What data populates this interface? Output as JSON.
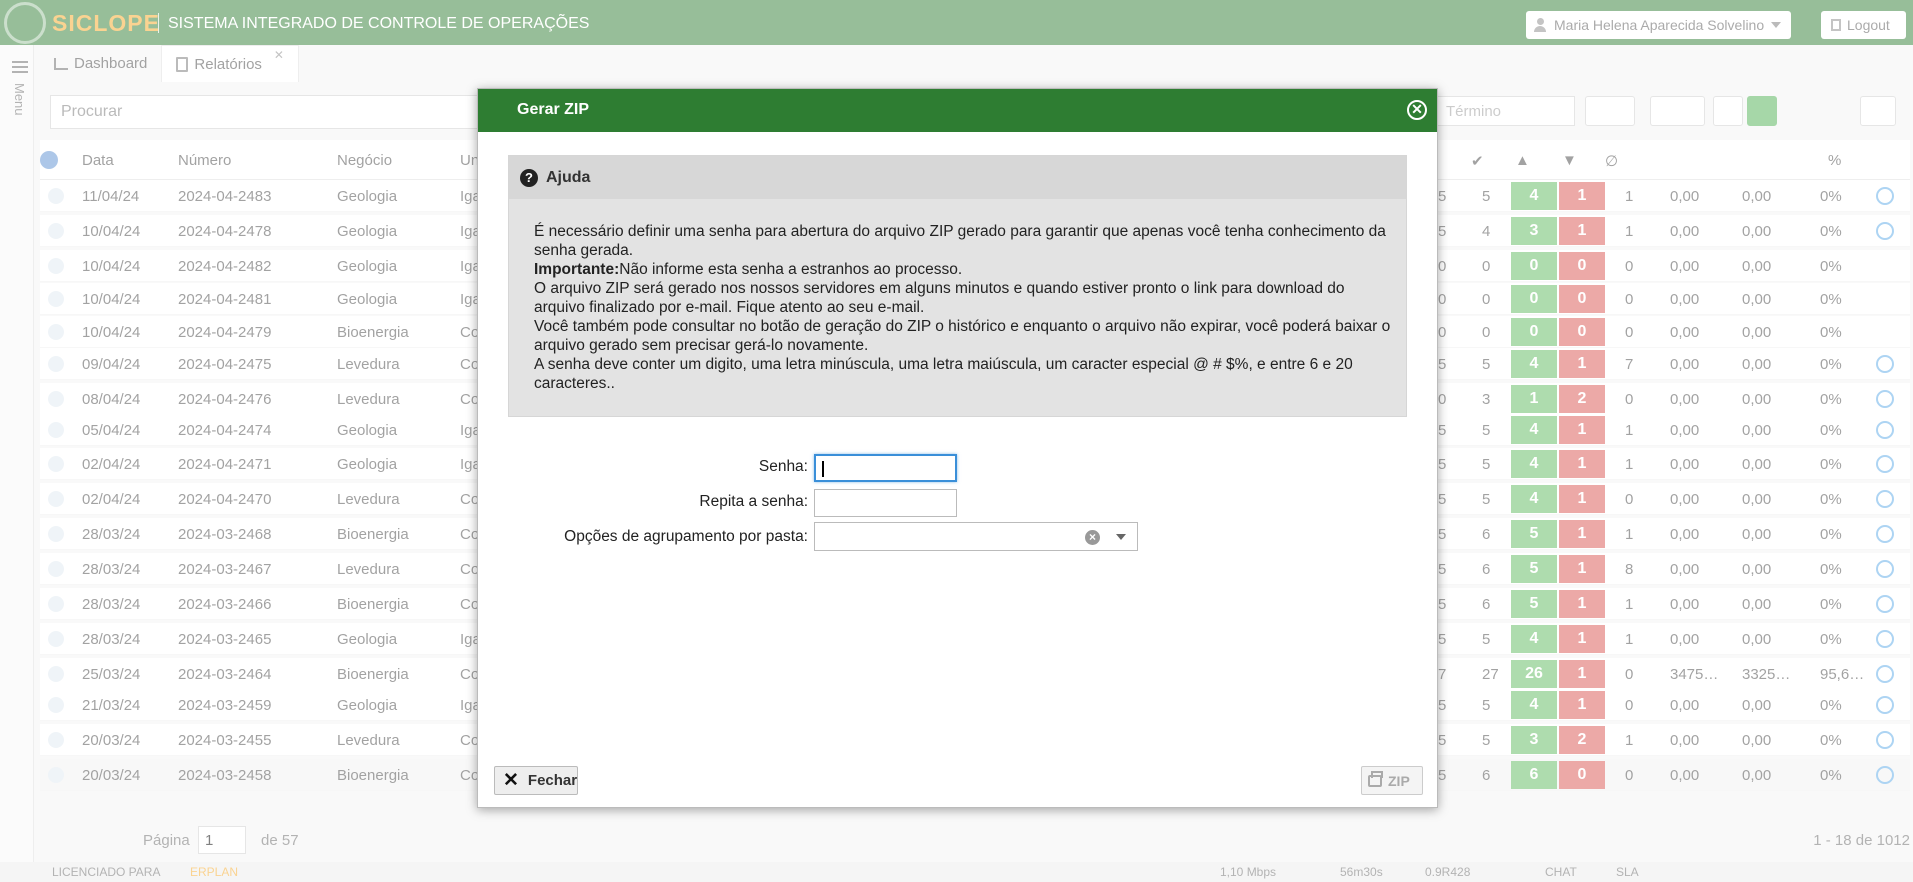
{
  "app": {
    "brand": "SICLOPE",
    "subtitle": "SISTEMA INTEGRADO DE CONTROLE DE OPERAÇÕES",
    "user": "Maria Helena Aparecida Solvelino",
    "logout": "Logout",
    "menu_label": "Menu",
    "tabs": [
      {
        "label": "Dashboard"
      },
      {
        "label": "Relatórios"
      }
    ],
    "search_placeholder": "Procurar",
    "termino_placeholder": "Término",
    "columns": [
      "Data",
      "Número",
      "Negócio",
      "Un"
    ],
    "rows": [
      {
        "data": "11/04/24",
        "numero": "2024-04-2483",
        "negocio": "Geologia",
        "un": "Iga",
        "a": "5",
        "b": "5",
        "up": "4",
        "down": "1",
        "c": "1",
        "v1": "0,00",
        "v2": "0,00",
        "pct": "0%"
      },
      {
        "data": "10/04/24",
        "numero": "2024-04-2478",
        "negocio": "Geologia",
        "un": "Iga",
        "a": "5",
        "b": "4",
        "up": "3",
        "down": "1",
        "c": "1",
        "v1": "0,00",
        "v2": "0,00",
        "pct": "0%"
      },
      {
        "data": "10/04/24",
        "numero": "2024-04-2482",
        "negocio": "Geologia",
        "un": "Iga",
        "a": "0",
        "b": "0",
        "up": "0",
        "down": "0",
        "c": "0",
        "v1": "0,00",
        "v2": "0,00",
        "pct": "0%"
      },
      {
        "data": "10/04/24",
        "numero": "2024-04-2481",
        "negocio": "Geologia",
        "un": "Iga",
        "a": "0",
        "b": "0",
        "up": "0",
        "down": "0",
        "c": "0",
        "v1": "0,00",
        "v2": "0,00",
        "pct": "0%"
      },
      {
        "data": "10/04/24",
        "numero": "2024-04-2479",
        "negocio": "Bioenergia",
        "un": "Co",
        "a": "0",
        "b": "0",
        "up": "0",
        "down": "0",
        "c": "0",
        "v1": "0,00",
        "v2": "0,00",
        "pct": "0%"
      },
      {
        "data": "09/04/24",
        "numero": "2024-04-2475",
        "negocio": "Levedura",
        "un": "Co",
        "a": "5",
        "b": "5",
        "up": "4",
        "down": "1",
        "c": "7",
        "v1": "0,00",
        "v2": "0,00",
        "pct": "0%"
      },
      {
        "data": "08/04/24",
        "numero": "2024-04-2476",
        "negocio": "Levedura",
        "un": "Co",
        "a": "0",
        "b": "3",
        "up": "1",
        "down": "2",
        "c": "0",
        "v1": "0,00",
        "v2": "0,00",
        "pct": "0%"
      },
      {
        "data": "05/04/24",
        "numero": "2024-04-2474",
        "negocio": "Geologia",
        "un": "Iga",
        "a": "5",
        "b": "5",
        "up": "4",
        "down": "1",
        "c": "1",
        "v1": "0,00",
        "v2": "0,00",
        "pct": "0%"
      },
      {
        "data": "02/04/24",
        "numero": "2024-04-2471",
        "negocio": "Geologia",
        "un": "Iga",
        "a": "5",
        "b": "5",
        "up": "4",
        "down": "1",
        "c": "1",
        "v1": "0,00",
        "v2": "0,00",
        "pct": "0%"
      },
      {
        "data": "02/04/24",
        "numero": "2024-04-2470",
        "negocio": "Levedura",
        "un": "Co",
        "a": "5",
        "b": "5",
        "up": "4",
        "down": "1",
        "c": "0",
        "v1": "0,00",
        "v2": "0,00",
        "pct": "0%"
      },
      {
        "data": "28/03/24",
        "numero": "2024-03-2468",
        "negocio": "Bioenergia",
        "un": "Co",
        "a": "5",
        "b": "6",
        "up": "5",
        "down": "1",
        "c": "1",
        "v1": "0,00",
        "v2": "0,00",
        "pct": "0%"
      },
      {
        "data": "28/03/24",
        "numero": "2024-03-2467",
        "negocio": "Levedura",
        "un": "Co",
        "a": "5",
        "b": "6",
        "up": "5",
        "down": "1",
        "c": "8",
        "v1": "0,00",
        "v2": "0,00",
        "pct": "0%"
      },
      {
        "data": "28/03/24",
        "numero": "2024-03-2466",
        "negocio": "Bioenergia",
        "un": "Co",
        "a": "5",
        "b": "6",
        "up": "5",
        "down": "1",
        "c": "1",
        "v1": "0,00",
        "v2": "0,00",
        "pct": "0%"
      },
      {
        "data": "28/03/24",
        "numero": "2024-03-2465",
        "negocio": "Geologia",
        "un": "Iga",
        "a": "5",
        "b": "5",
        "up": "4",
        "down": "1",
        "c": "1",
        "v1": "0,00",
        "v2": "0,00",
        "pct": "0%"
      },
      {
        "data": "25/03/24",
        "numero": "2024-03-2464",
        "negocio": "Bioenergia",
        "un": "Co",
        "a": "7",
        "b": "27",
        "up": "26",
        "down": "1",
        "c": "0",
        "v1": "3475…",
        "v2": "3325…",
        "pct": "95,6…"
      },
      {
        "data": "21/03/24",
        "numero": "2024-03-2459",
        "negocio": "Geologia",
        "un": "Iga",
        "a": "5",
        "b": "5",
        "up": "4",
        "down": "1",
        "c": "0",
        "v1": "0,00",
        "v2": "0,00",
        "pct": "0%"
      },
      {
        "data": "20/03/24",
        "numero": "2024-03-2455",
        "negocio": "Levedura",
        "un": "Co",
        "a": "5",
        "b": "5",
        "up": "3",
        "down": "2",
        "c": "1",
        "v1": "0,00",
        "v2": "0,00",
        "pct": "0%"
      },
      {
        "data": "20/03/24",
        "numero": "2024-03-2458",
        "negocio": "Bioenergia",
        "un": "Co",
        "a": "5",
        "b": "6",
        "up": "6",
        "down": "0",
        "c": "0",
        "v1": "0,00",
        "v2": "0,00",
        "pct": "0%"
      }
    ],
    "pager": {
      "pagina_label": "Página",
      "page_value": "1",
      "of_label": "de 57",
      "range": "1 - 18 de 1012"
    },
    "status": {
      "license": "LICENCIADO PARA",
      "vendor": "ERPLAN",
      "speed": "1,10 Mbps",
      "time": "56m30s",
      "views": "0.9R428",
      "chat": "CHAT",
      "sla": "SLA"
    }
  },
  "modal": {
    "title": "Gerar ZIP",
    "help_title": "Ajuda",
    "help_p1": "É necessário definir uma senha para abertura do arquivo ZIP gerado para garantir que apenas você tenha conhecimento da senha gerada.",
    "help_important_label": "Importante:",
    "help_important_text": "Não informe esta senha a estranhos ao processo.",
    "help_p3": "O arquivo ZIP será gerado nos nossos servidores em alguns minutos e quando estiver pronto o link para download do arquivo finalizado por e-mail. Fique atento ao seu e-mail.",
    "help_p4": "Você também pode consultar no botão de geração do ZIP o histórico e enquanto o arquivo não expirar, você poderá baixar o arquivo gerado sem precisar gerá-lo novamente.",
    "help_p5": "A senha deve conter um digito, uma letra minúscula, uma letra maiúscula, um caracter especial @ # $%, e entre 6 e 20 caracteres..",
    "senha_label": "Senha:",
    "repita_label": "Repita a senha:",
    "agrupamento_label": "Opções de agrupamento por pasta:",
    "senha_value": "",
    "repita_value": "",
    "agrupamento_value": "",
    "fechar_label": "Fechar",
    "zip_label": "ZIP"
  },
  "colors": {
    "header_green": "#2e7d32",
    "brand_orange": "#f5a623",
    "pill_green": "#5cb85c",
    "pill_red": "#d9534f",
    "focus_blue": "#3a8fd9"
  },
  "icons": [
    "logo-icon",
    "user-icon",
    "logout-icon",
    "menu-icon",
    "chart-icon",
    "pdf-icon",
    "help-icon",
    "close-icon",
    "x-icon",
    "printer-icon",
    "thumbs-up-icon",
    "thumbs-down-icon",
    "check-icon",
    "paperclip-icon"
  ]
}
